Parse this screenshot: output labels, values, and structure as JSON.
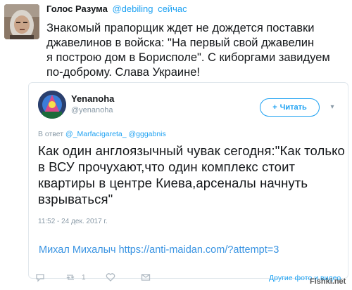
{
  "top_tweet": {
    "name": "Голос Разума",
    "handle": "@debiling",
    "time": "сейчас",
    "text": "Знакомый прапорщик ждет не дождется поставки\nджавелинов в войска: \"На первый свой джавелин\nя построю дом в Борисполе\". С киборгами завидуем\nпо-доброму. Слава Украине!"
  },
  "embedded_tweet": {
    "name": "Yenanoha",
    "handle": "@yenanoha",
    "follow_label": "Читать",
    "reply_prefix": "В ответ",
    "reply_mentions": "@_Marfacigareta_ @gggabnis",
    "text": "Как один англоязычный чувак сегодня:\"Как только в ВСУ прочухают,что один комплекс стоит квартиры в центре Киева,арсеналы начнуть взрываться\"",
    "timestamp": "11:52 - 24 дек. 2017 г."
  },
  "link_line": "Михал Михалыч https://anti-maidan.com/?attempt=3",
  "action_bar": {
    "retweet_count": "1",
    "other_photos": "Другие фото и видео"
  },
  "watermark": "Fishki.net"
}
